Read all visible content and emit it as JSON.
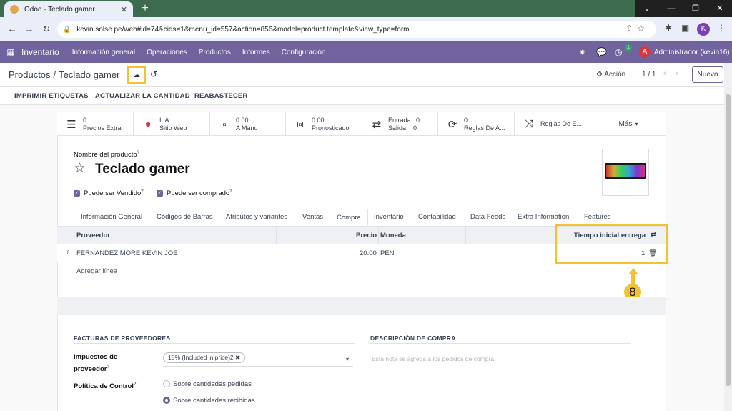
{
  "browser": {
    "tab_title": "Odoo - Teclado gamer",
    "url": "kevin.solse.pe/web#id=74&cids=1&menu_id=557&action=856&model=product.template&view_type=form",
    "profile_initial": "K"
  },
  "navbar": {
    "app_name": "Inventario",
    "menus": [
      "Información general",
      "Operaciones",
      "Productos",
      "Informes",
      "Configuración"
    ],
    "activity_count": "1",
    "user_initial": "A",
    "user_name": "Administrador (kevin16)"
  },
  "control_panel": {
    "breadcrumb_parent": "Productos",
    "breadcrumb_sep": "/",
    "breadcrumb_current": "Teclado gamer",
    "action_label": "Acción",
    "pager": "1 / 1",
    "new_button": "Nuevo"
  },
  "action_buttons": [
    "IMPRIMIR ETIQUETAS",
    "ACTUALIZAR LA CANTIDAD",
    "REABASTECER"
  ],
  "smart_buttons": {
    "prices": {
      "value": "0",
      "label": "Precios Extra"
    },
    "website": {
      "value": "Ir A",
      "label": "Sitio Web"
    },
    "on_hand": {
      "value": "0.00 ...",
      "label": "A Mano"
    },
    "forecast": {
      "value": "0.00 ...",
      "label": "Pronosticado"
    },
    "moves": {
      "in_label": "Entrada:",
      "in_value": "0",
      "out_label": "Salida:",
      "out_value": "0"
    },
    "rules": {
      "value": "0",
      "label": "Reglas De A..."
    },
    "routes": {
      "label": "Reglas De E..."
    },
    "more": "Más"
  },
  "product": {
    "name_label": "Nombre del producto",
    "name": "Teclado gamer",
    "can_be_sold": "Puede ser Vendido",
    "can_be_purchased": "Puede ser comprado"
  },
  "tabs": [
    "Información General",
    "Códigos de Barras",
    "Atributos y variantes",
    "Ventas",
    "Compra",
    "Inventario",
    "Contabilidad",
    "Data Feeds",
    "Extra Information",
    "Features"
  ],
  "vendor_table": {
    "headers": {
      "vendor": "Proveedor",
      "price": "Precio",
      "currency": "Moneda",
      "lead_time": "Tiempo inicial entrega"
    },
    "rows": [
      {
        "vendor": "FERNANDEZ MORE KEVIN JOE",
        "price": "20.00",
        "currency": "PEN",
        "lead_time": "1"
      }
    ],
    "add_line": "Agregar línea"
  },
  "annotation": {
    "step": "8",
    "color": "#f2c230"
  },
  "purchase": {
    "bills_header": "FACTURAS DE PROVEEDORES",
    "desc_header": "DESCRIPCIÓN DE COMPRA",
    "taxes_label_1": "Impuestos de",
    "taxes_label_2": "proveedor",
    "tax_tag": "18% (Included in price)2",
    "desc_placeholder": "Esta nota se agrega a los pedidos de compra.",
    "control_policy_label": "Política de Control",
    "policy_options": [
      "Sobre cantidades pedidas",
      "Sobre cantidades recibidas"
    ],
    "policy_selected": 1
  },
  "colors": {
    "brand": "#71639e",
    "highlight": "#f2c230"
  }
}
